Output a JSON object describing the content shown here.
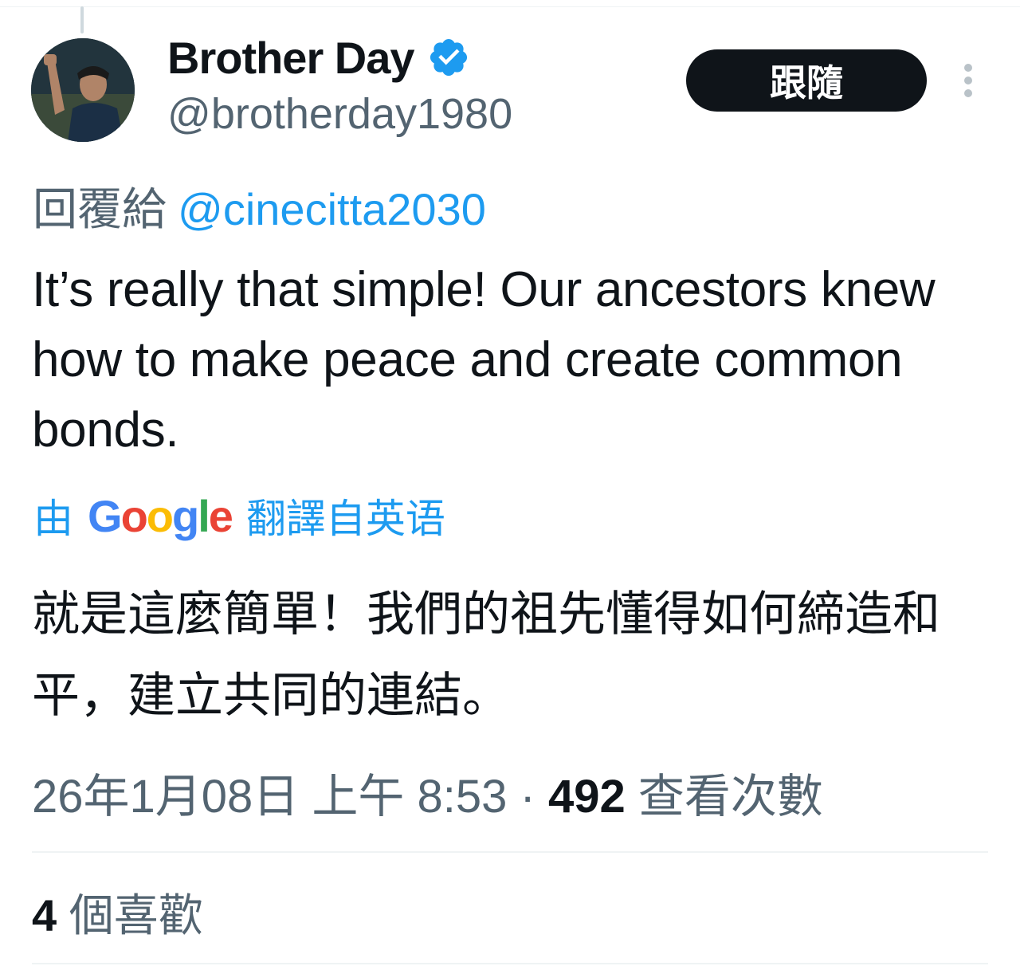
{
  "tweet": {
    "author": {
      "display_name": "Brother Day",
      "handle": "@brotherday1980",
      "verified": true,
      "avatar_icon": "profile-photo"
    },
    "follow_label": "跟隨",
    "more_icon": "more-vertical-icon",
    "reply": {
      "prefix": "回覆給",
      "mention": "@cinecitta2030"
    },
    "text": "It’s really that simple! Our ancestors knew how to make peace and create common bonds.",
    "translation": {
      "prefix": "由",
      "provider": "Google",
      "suffix": "翻譯自英语",
      "text": "就是這麼簡單！我們的祖先懂得如何締造和平，建立共同的連結。"
    },
    "meta": {
      "timestamp": "26年1月08日 上午 8:53",
      "separator": "·",
      "views_count": "492",
      "views_label": "查看次數"
    },
    "likes": {
      "count": "4",
      "label": "個喜歡"
    }
  },
  "colors": {
    "accent": "#1d9bf0",
    "text_primary": "#0f1419",
    "text_secondary": "#536471",
    "follow_button_bg": "#0f1419"
  }
}
